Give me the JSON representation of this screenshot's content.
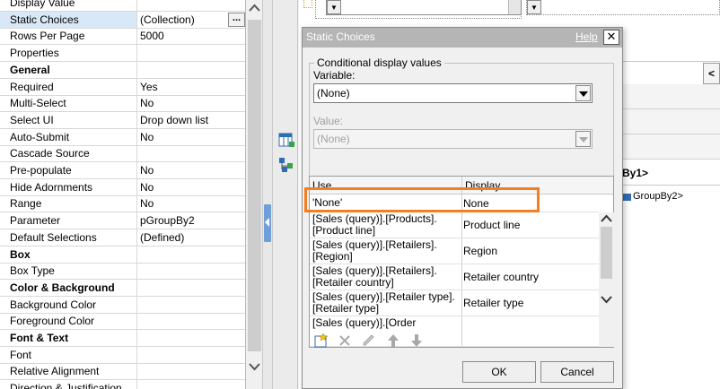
{
  "properties": [
    {
      "name": "Display Value",
      "value": "",
      "type": "row"
    },
    {
      "name": "Static Choices",
      "value": "(Collection)",
      "type": "selected"
    },
    {
      "name": "Rows Per Page",
      "value": "5000",
      "type": "row"
    },
    {
      "name": "Properties",
      "value": "",
      "type": "row"
    },
    {
      "name": "General",
      "value": "",
      "type": "header"
    },
    {
      "name": "Required",
      "value": "Yes",
      "type": "row"
    },
    {
      "name": "Multi-Select",
      "value": "No",
      "type": "row"
    },
    {
      "name": "Select UI",
      "value": "Drop down list",
      "type": "row"
    },
    {
      "name": "Auto-Submit",
      "value": "No",
      "type": "row"
    },
    {
      "name": "Cascade Source",
      "value": "",
      "type": "row"
    },
    {
      "name": "Pre-populate",
      "value": "No",
      "type": "row"
    },
    {
      "name": "Hide Adornments",
      "value": "No",
      "type": "row"
    },
    {
      "name": "Range",
      "value": "No",
      "type": "row"
    },
    {
      "name": "Parameter",
      "value": "pGroupBy2",
      "type": "row"
    },
    {
      "name": "Default Selections",
      "value": "(Defined)",
      "type": "row"
    },
    {
      "name": "Box",
      "value": "",
      "type": "header"
    },
    {
      "name": "Box Type",
      "value": "",
      "type": "row"
    },
    {
      "name": "Color & Background",
      "value": "",
      "type": "header"
    },
    {
      "name": "Background Color",
      "value": "",
      "type": "row"
    },
    {
      "name": "Foreground Color",
      "value": "",
      "type": "row"
    },
    {
      "name": "Font & Text",
      "value": "",
      "type": "header"
    },
    {
      "name": "Font",
      "value": "",
      "type": "row"
    },
    {
      "name": "Relative Alignment",
      "value": "",
      "type": "row"
    },
    {
      "name": "Direction & Justification",
      "value": "",
      "type": "row"
    }
  ],
  "ellipsis_label": "...",
  "work": {
    "label_by1": "By1>",
    "label_groupby2": "GroupBy2>",
    "label_lt": "<"
  },
  "dialog": {
    "title": "Static Choices",
    "help": "Help",
    "close": "✕",
    "group_legend": "Conditional display values",
    "variable_label": "Variable:",
    "variable_value": "(None)",
    "value_label": "Value:",
    "value_value": "(None)",
    "table": {
      "headers": {
        "use": "Use",
        "display": "Display"
      },
      "rows": [
        {
          "use": "'None'",
          "display": "None"
        },
        {
          "use": "[Sales (query)].[Products].[Product line]",
          "display": "Product line"
        },
        {
          "use": "[Sales (query)].[Retailers].[Region]",
          "display": "Region"
        },
        {
          "use": "[Sales (query)].[Retailers].[Retailer country]",
          "display": "Retailer country"
        },
        {
          "use": "[Sales (query)].[Retailer type].[Retailer type]",
          "display": "Retailer type"
        },
        {
          "use": "[Sales (query)].[Order",
          "display": ""
        }
      ]
    },
    "ok": "OK",
    "cancel": "Cancel"
  },
  "colors": {
    "highlight": "#f47e20",
    "selected_row": "#d9e8f7",
    "grip": "#6f9fd8"
  }
}
